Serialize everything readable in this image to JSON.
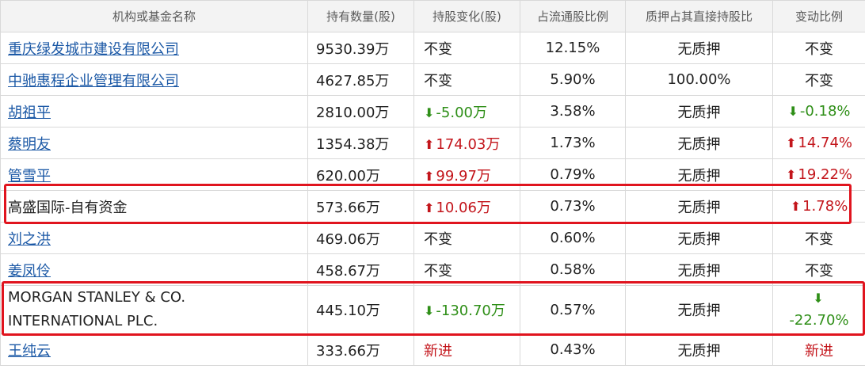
{
  "columns": [
    "机构或基金名称",
    "持有数量(股)",
    "持股变化(股)",
    "占流通股比例",
    "质押占其直接持股比",
    "变动比例"
  ],
  "rows": [
    {
      "name": "重庆绿发城市建设有限公司",
      "link": true,
      "qty": "9530.39万",
      "change": "不变",
      "change_dir": "none",
      "float_pct": "12.15%",
      "pledge": "无质押",
      "ratio": "不变",
      "ratio_dir": "none"
    },
    {
      "name": "中驰惠程企业管理有限公司",
      "link": true,
      "qty": "4627.85万",
      "change": "不变",
      "change_dir": "none",
      "float_pct": "5.90%",
      "pledge": "100.00%",
      "ratio": "不变",
      "ratio_dir": "none"
    },
    {
      "name": "胡祖平",
      "link": true,
      "qty": "2810.00万",
      "change": "-5.00万",
      "change_dir": "down",
      "float_pct": "3.58%",
      "pledge": "无质押",
      "ratio": "-0.18%",
      "ratio_dir": "down"
    },
    {
      "name": "蔡明友",
      "link": true,
      "qty": "1354.38万",
      "change": "174.03万",
      "change_dir": "up",
      "float_pct": "1.73%",
      "pledge": "无质押",
      "ratio": "14.74%",
      "ratio_dir": "up"
    },
    {
      "name": "管雪平",
      "link": true,
      "qty": "620.00万",
      "change": "99.97万",
      "change_dir": "up",
      "float_pct": "0.79%",
      "pledge": "无质押",
      "ratio": "19.22%",
      "ratio_dir": "up"
    },
    {
      "name": "高盛国际-自有资金",
      "link": false,
      "qty": "573.66万",
      "change": "10.06万",
      "change_dir": "up",
      "float_pct": "0.73%",
      "pledge": "无质押",
      "ratio": "1.78%",
      "ratio_dir": "up"
    },
    {
      "name": "刘之洪",
      "link": true,
      "qty": "469.06万",
      "change": "不变",
      "change_dir": "none",
      "float_pct": "0.60%",
      "pledge": "无质押",
      "ratio": "不变",
      "ratio_dir": "none"
    },
    {
      "name": "姜凤伶",
      "link": true,
      "qty": "458.67万",
      "change": "不变",
      "change_dir": "none",
      "float_pct": "0.58%",
      "pledge": "无质押",
      "ratio": "不变",
      "ratio_dir": "none"
    },
    {
      "name": "MORGAN STANLEY & CO. INTERNATIONAL PLC.",
      "link": false,
      "qty": "445.10万",
      "change": "-130.70万",
      "change_dir": "down",
      "float_pct": "0.57%",
      "pledge": "无质押",
      "ratio": "-22.70%",
      "ratio_dir": "down"
    },
    {
      "name": "王纯云",
      "link": true,
      "qty": "333.66万",
      "change": "新进",
      "change_dir": "new",
      "float_pct": "0.43%",
      "pledge": "无质押",
      "ratio": "新进",
      "ratio_dir": "new"
    }
  ],
  "colors": {
    "up": "#c3151b",
    "down": "#2f8f18",
    "link": "#1c59a6",
    "highlight": "#e0141e"
  },
  "icons": {
    "up": "arrow-up-icon",
    "down": "arrow-down-icon"
  }
}
